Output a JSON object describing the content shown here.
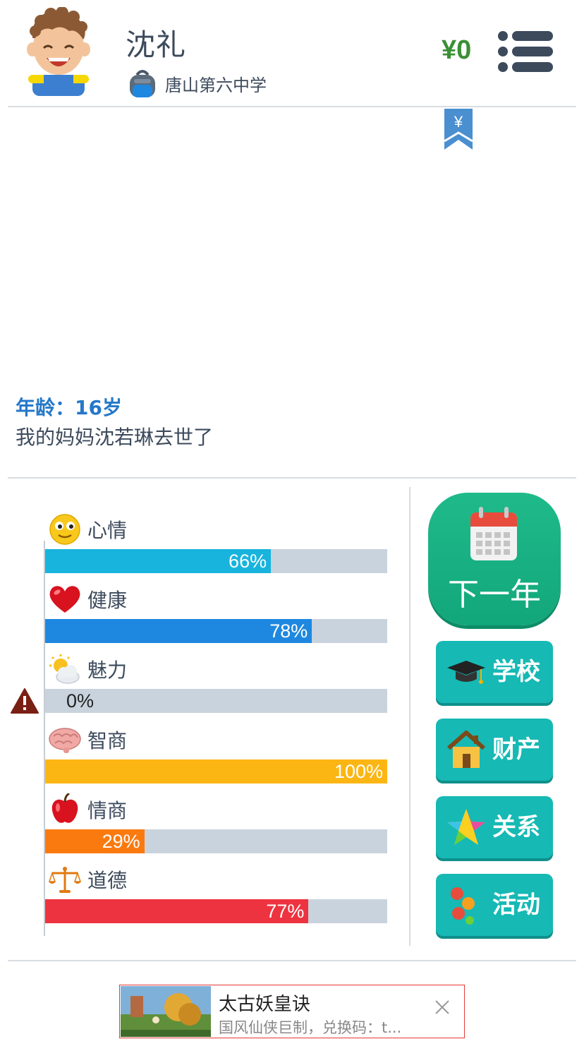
{
  "header": {
    "name": "沈礼",
    "school": "唐山第六中学",
    "money": "¥0"
  },
  "log": {
    "age": "年龄：16岁",
    "event": "我的妈妈沈若琳去世了"
  },
  "stats": [
    {
      "label": "心情",
      "percent": 66,
      "percent_text": "66%",
      "color": "#18b4de",
      "icon": "smiley-icon"
    },
    {
      "label": "健康",
      "percent": 78,
      "percent_text": "78%",
      "color": "#1e88e0",
      "icon": "heart-icon"
    },
    {
      "label": "魅力",
      "percent": 0,
      "percent_text": "0%",
      "color": "#9aa7b4",
      "icon": "sun-cloud-icon"
    },
    {
      "label": "智商",
      "percent": 100,
      "percent_text": "100%",
      "color": "#fcb614",
      "icon": "brain-icon"
    },
    {
      "label": "情商",
      "percent": 29,
      "percent_text": "29%",
      "color": "#fa7a10",
      "icon": "apple-icon"
    },
    {
      "label": "道德",
      "percent": 77,
      "percent_text": "77%",
      "color": "#ee3340",
      "icon": "scales-icon"
    }
  ],
  "actions": {
    "next_year": "下一年",
    "school": "学校",
    "property": "财产",
    "relations": "关系",
    "activities": "活动"
  },
  "ad": {
    "title": "太古妖皇诀",
    "description": "国风仙侠巨制，兑换码：t..."
  }
}
